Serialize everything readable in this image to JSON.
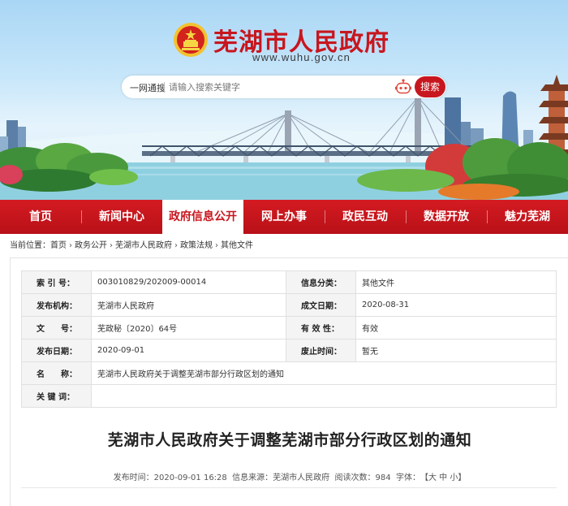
{
  "header": {
    "site_title": "芜湖市人民政府",
    "site_url": "www.wuhu.gov.cn",
    "emblem_icon": "national-emblem-icon",
    "brand_color": "#c8161e"
  },
  "search": {
    "scope_label": "一网通搜",
    "placeholder": "请输入搜索关键字",
    "button_label": "搜索",
    "assistant_icon": "robot-icon"
  },
  "nav": {
    "items": [
      {
        "label": "首页"
      },
      {
        "label": "新闻中心"
      },
      {
        "label": "政府信息公开"
      },
      {
        "label": "网上办事"
      },
      {
        "label": "政民互动"
      },
      {
        "label": "数据开放"
      },
      {
        "label": "魅力芜湖"
      }
    ],
    "active_index": 2
  },
  "breadcrumb": {
    "prefix": "当前位置：",
    "items": [
      "首页",
      "政务公开",
      "芜湖市人民政府",
      "政策法规",
      "其他文件"
    ],
    "separator": "›"
  },
  "meta": {
    "index_no_label": "索 引 号：",
    "index_no": "003010829/202009-00014",
    "category_label": "信息分类：",
    "category": "其他文件",
    "publisher_label": "发布机构：",
    "publisher": "芜湖市人民政府",
    "created_label": "成文日期：",
    "created": "2020-08-31",
    "doc_no_label": "文　　号：",
    "doc_no": "芜政秘〔2020〕64号",
    "validity_label": "有 效 性：",
    "validity": "有效",
    "publish_date_label": "发布日期：",
    "publish_date": "2020-09-01",
    "repeal_label": "废止时间：",
    "repeal": "暂无",
    "name_label": "名　　称：",
    "name": "芜湖市人民政府关于调整芜湖市部分行政区划的通知",
    "keywords_label": "关 键 词：",
    "keywords": ""
  },
  "article": {
    "title": "芜湖市人民政府关于调整芜湖市部分行政区划的通知",
    "publish_time_label": "发布时间：",
    "publish_time": "2020-09-01 16:28",
    "source_label": "信息来源：",
    "source": "芜湖市人民政府",
    "views_label": "阅读次数：",
    "views": "984",
    "font_label": "字体：",
    "font_open": "【",
    "font_large": "大",
    "font_medium": "中",
    "font_small": "小",
    "font_close": "】"
  }
}
